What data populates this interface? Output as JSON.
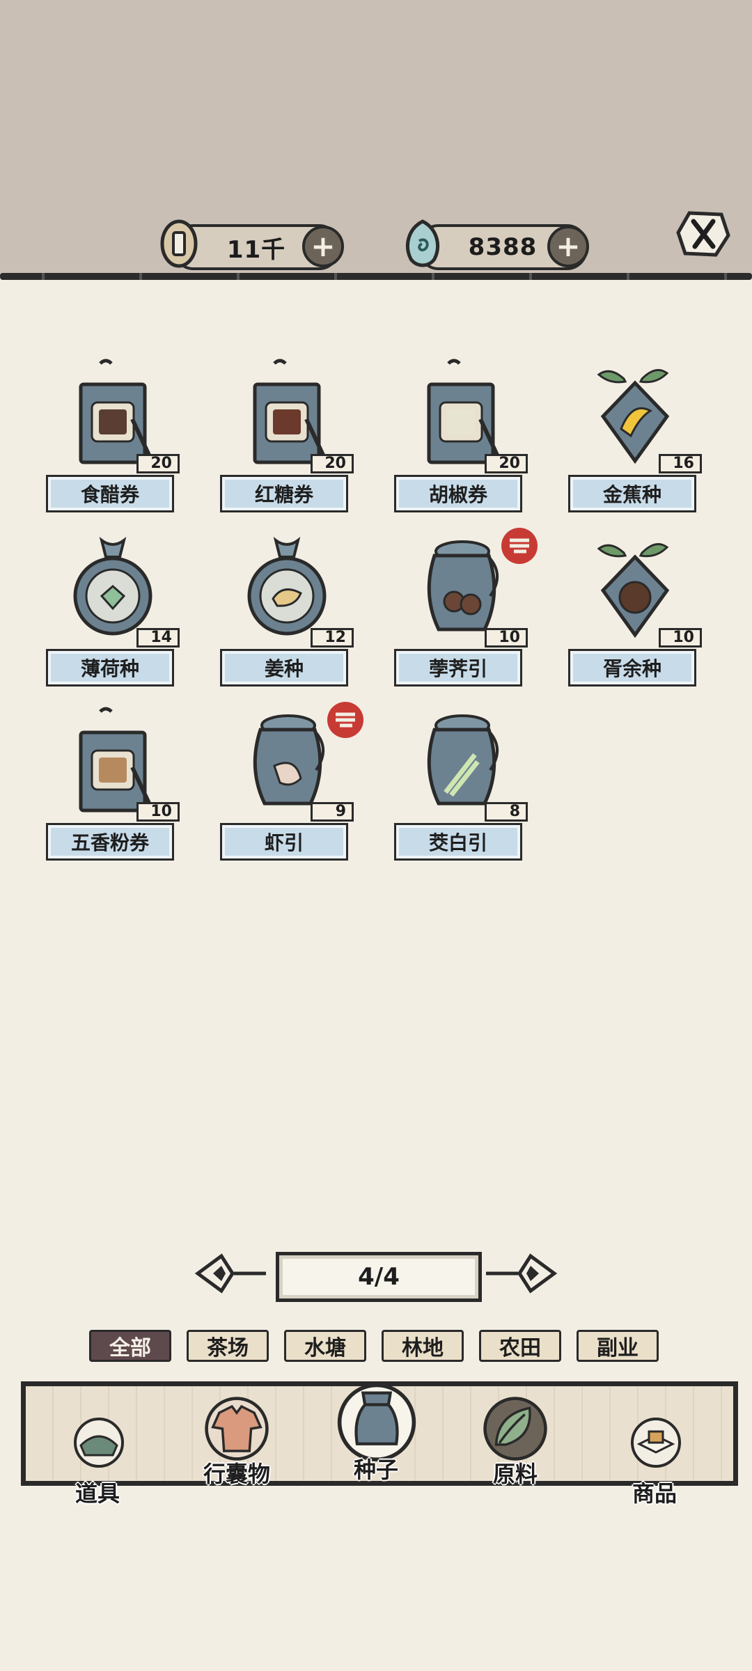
{
  "currency": {
    "coins": "11千",
    "jade": "8388"
  },
  "items": [
    {
      "name": "食醋券",
      "count": "20",
      "art": "ticket-vinegar",
      "new": false
    },
    {
      "name": "红糖券",
      "count": "20",
      "art": "ticket-brown-sugar",
      "new": false
    },
    {
      "name": "胡椒券",
      "count": "20",
      "art": "ticket-pepper",
      "new": false
    },
    {
      "name": "金蕉种",
      "count": "16",
      "art": "seed-banana",
      "new": false
    },
    {
      "name": "薄荷种",
      "count": "14",
      "art": "seed-mint",
      "new": false
    },
    {
      "name": "姜种",
      "count": "12",
      "art": "seed-ginger",
      "new": false
    },
    {
      "name": "荸荠引",
      "count": "10",
      "art": "pouch-water-chestnut",
      "new": true
    },
    {
      "name": "胥余种",
      "count": "10",
      "art": "seed-coconut",
      "new": false
    },
    {
      "name": "五香粉券",
      "count": "10",
      "art": "ticket-five-spice",
      "new": false
    },
    {
      "name": "虾引",
      "count": "9",
      "art": "pouch-shrimp",
      "new": true
    },
    {
      "name": "茭白引",
      "count": "8",
      "art": "pouch-wild-rice",
      "new": false
    }
  ],
  "pagination": {
    "label": "4/4"
  },
  "filters": [
    "全部",
    "茶场",
    "水塘",
    "林地",
    "农田",
    "副业"
  ],
  "categories": [
    "道具",
    "行囊物",
    "种子",
    "原料",
    "商品"
  ],
  "colors": {
    "accent": "#5e4a4d",
    "plate": "#c8dbe8",
    "slate": "#6c8291"
  }
}
